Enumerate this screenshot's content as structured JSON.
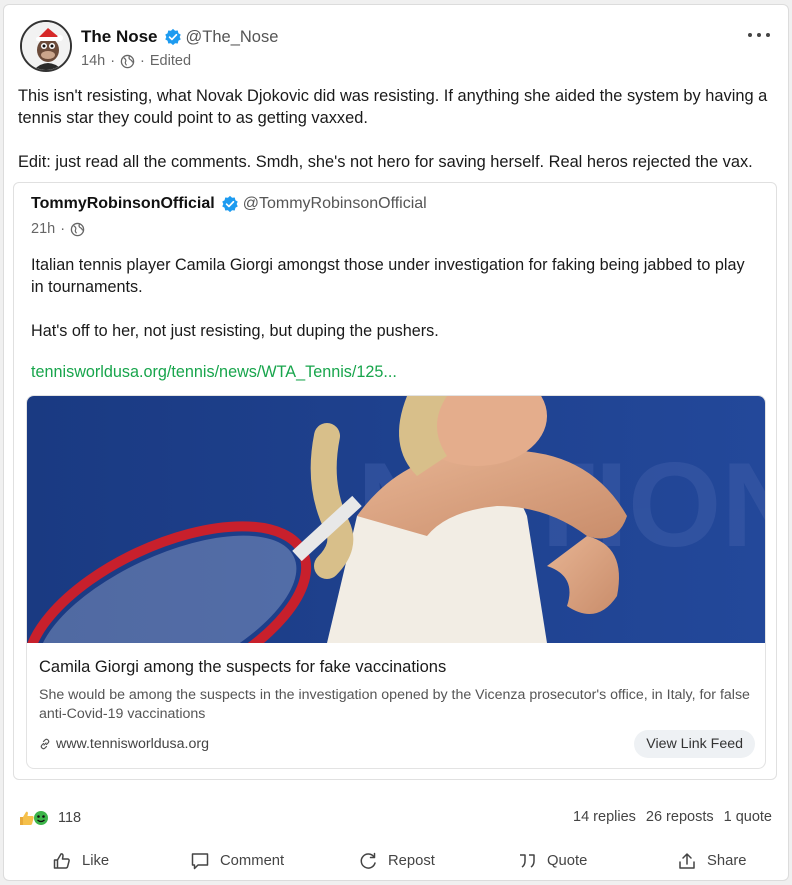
{
  "post": {
    "author_name": "The Nose",
    "handle": "@The_Nose",
    "time": "14h",
    "edited": "Edited",
    "text_p1": "This isn't resisting, what Novak Djokovic did was resisting. If anything she aided the system by having a tennis star they could point to as getting vaxxed.",
    "text_p2": "Edit: just read all the comments. Smdh, she's not hero for saving herself. Real heros rejected the vax."
  },
  "quoted": {
    "author_name": "TommyRobinsonOfficial",
    "handle": "@TommyRobinsonOfficial",
    "time": "21h",
    "text_p1": "Italian tennis player Camila Giorgi amongst those under investigation for faking being jabbed to play in tournaments.",
    "text_p2": "Hat's off to her, not just resisting, but duping the pushers.",
    "link_text": "tennisworldusa.org/tennis/news/WTA_Tennis/125...",
    "link_card": {
      "title": "Camila Giorgi among the suspects for fake vaccinations",
      "description": "She would be among the suspects in the investigation opened by the Vicenza prosecutor's office, in Italy, for false anti-Covid-19 vaccinations",
      "domain": "www.tennisworldusa.org",
      "button": "View Link Feed",
      "image_backdrop_text": "NATIONA"
    }
  },
  "stats": {
    "reactions_count": "118",
    "replies": "14 replies",
    "reposts": "26 reposts",
    "quotes": "1 quote"
  },
  "actions": {
    "like": "Like",
    "comment": "Comment",
    "repost": "Repost",
    "quote": "Quote",
    "share": "Share"
  },
  "icons": [
    "verified-icon",
    "globe-icon",
    "more-icon",
    "link-icon",
    "thumbs-up-icon",
    "comment-icon",
    "repost-icon",
    "quote-icon",
    "share-icon"
  ],
  "colors": {
    "link": "#18a54c",
    "verified": "#1d9bf0",
    "accent_blue": "#1f3c88"
  }
}
